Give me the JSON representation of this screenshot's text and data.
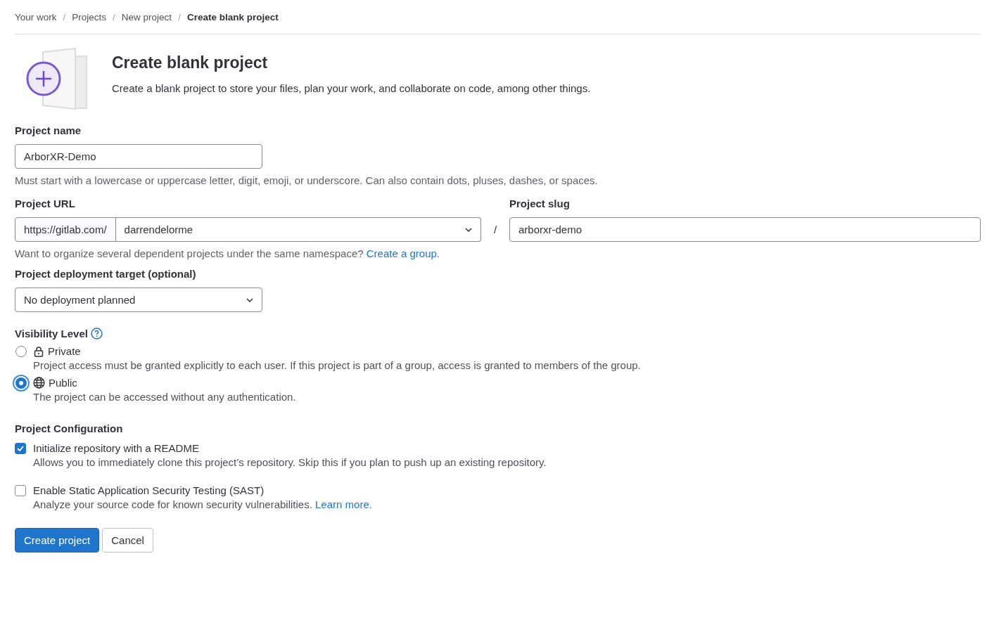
{
  "breadcrumb": [
    {
      "label": "Your work",
      "current": false,
      "separator": "/"
    },
    {
      "label": "Projects",
      "current": false,
      "separator": "/"
    },
    {
      "label": "New project",
      "current": false,
      "separator": "/"
    },
    {
      "label": "Create blank project",
      "current": true
    }
  ],
  "header": {
    "title": "Create blank project",
    "description": "Create a blank project to store your files, plan your work, and collaborate on code, among other things."
  },
  "project_name": {
    "label": "Project name",
    "value": "ArborXR-Demo",
    "help": "Must start with a lowercase or uppercase letter, digit, emoji, or underscore. Can also contain dots, pluses, dashes, or spaces."
  },
  "project_url": {
    "label": "Project URL",
    "prefix": "https://gitlab.com/",
    "namespace": "darrendelorme",
    "separator": "/",
    "help": "Want to organize several dependent projects under the same namespace?",
    "help_link": "Create a group."
  },
  "project_slug": {
    "label": "Project slug",
    "value": "arborxr-demo"
  },
  "deployment_target": {
    "label": "Project deployment target (optional)",
    "value": "No deployment planned"
  },
  "visibility": {
    "label": "Visibility Level",
    "options": [
      {
        "kind": "lock",
        "label": "Private",
        "selected": false,
        "description": "Project access must be granted explicitly to each user. If this project is part of a group, access is granted to members of the group."
      },
      {
        "kind": "globe",
        "label": "Public",
        "selected": true,
        "description": "The project can be accessed without any authentication."
      }
    ]
  },
  "configuration": {
    "label": "Project Configuration",
    "options": [
      {
        "label": "Initialize repository with a README",
        "checked": true,
        "description": "Allows you to immediately clone this project’s repository. Skip this if you plan to push up an existing repository."
      },
      {
        "label": "Enable Static Application Security Testing (SAST)",
        "checked": false,
        "description": "Analyze your source code for known security vulnerabilities.",
        "link": "Learn more."
      }
    ]
  },
  "buttons": [
    {
      "label": "Create project",
      "kind": "primary"
    },
    {
      "label": "Cancel",
      "kind": "default"
    }
  ]
}
